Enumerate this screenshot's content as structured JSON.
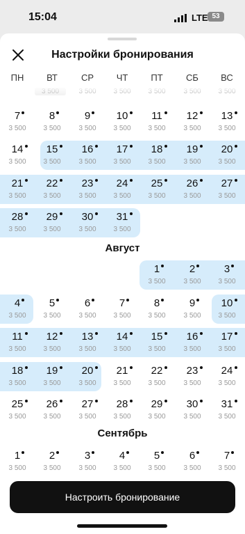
{
  "status_bar": {
    "time": "15:04",
    "network": "LTE",
    "battery": "53"
  },
  "header": {
    "title": "Настройки бронирования",
    "close_icon": "close-icon"
  },
  "weekdays": [
    "ПН",
    "ВТ",
    "СР",
    "ЧТ",
    "ПТ",
    "СБ",
    "ВС"
  ],
  "colors": {
    "selected_range": "#d6ecfb",
    "button": "#111111"
  },
  "july": {
    "top_row_price": "3 500",
    "weeks": [
      [
        {
          "day": "7",
          "price": "3 500"
        },
        {
          "day": "8",
          "price": "3 500"
        },
        {
          "day": "9",
          "price": "3 500"
        },
        {
          "day": "10",
          "price": "3 500"
        },
        {
          "day": "11",
          "price": "3 500"
        },
        {
          "day": "12",
          "price": "3 500"
        },
        {
          "day": "13",
          "price": "3 500"
        }
      ],
      [
        {
          "day": "14",
          "price": "3 500"
        },
        {
          "day": "15",
          "price": "3 500"
        },
        {
          "day": "16",
          "price": "3 500"
        },
        {
          "day": "17",
          "price": "3 500"
        },
        {
          "day": "18",
          "price": "3 500"
        },
        {
          "day": "19",
          "price": "3 500"
        },
        {
          "day": "20",
          "price": "3 500"
        }
      ],
      [
        {
          "day": "21",
          "price": "3 500"
        },
        {
          "day": "22",
          "price": "3 500"
        },
        {
          "day": "23",
          "price": "3 500"
        },
        {
          "day": "24",
          "price": "3 500"
        },
        {
          "day": "25",
          "price": "3 500"
        },
        {
          "day": "26",
          "price": "3 500"
        },
        {
          "day": "27",
          "price": "3 500"
        }
      ],
      [
        {
          "day": "28",
          "price": "3 500"
        },
        {
          "day": "29",
          "price": "3 500"
        },
        {
          "day": "30",
          "price": "3 500"
        },
        {
          "day": "31",
          "price": "3 500"
        }
      ]
    ]
  },
  "august": {
    "title": "Август",
    "weeks": [
      [
        null,
        null,
        null,
        null,
        {
          "day": "1",
          "price": "3 500"
        },
        {
          "day": "2",
          "price": "3 500"
        },
        {
          "day": "3",
          "price": "3 500"
        }
      ],
      [
        {
          "day": "4",
          "price": "3 500"
        },
        {
          "day": "5",
          "price": "3 500"
        },
        {
          "day": "6",
          "price": "3 500"
        },
        {
          "day": "7",
          "price": "3 500"
        },
        {
          "day": "8",
          "price": "3 500"
        },
        {
          "day": "9",
          "price": "3 500"
        },
        {
          "day": "10",
          "price": "3 500"
        }
      ],
      [
        {
          "day": "11",
          "price": "3 500"
        },
        {
          "day": "12",
          "price": "3 500"
        },
        {
          "day": "13",
          "price": "3 500"
        },
        {
          "day": "14",
          "price": "3 500"
        },
        {
          "day": "15",
          "price": "3 500"
        },
        {
          "day": "16",
          "price": "3 500"
        },
        {
          "day": "17",
          "price": "3 500"
        }
      ],
      [
        {
          "day": "18",
          "price": "3 500"
        },
        {
          "day": "19",
          "price": "3 500"
        },
        {
          "day": "20",
          "price": "3 500"
        },
        {
          "day": "21",
          "price": "3 500"
        },
        {
          "day": "22",
          "price": "3 500"
        },
        {
          "day": "23",
          "price": "3 500"
        },
        {
          "day": "24",
          "price": "3 500"
        }
      ],
      [
        {
          "day": "25",
          "price": "3 500"
        },
        {
          "day": "26",
          "price": "3 500"
        },
        {
          "day": "27",
          "price": "3 500"
        },
        {
          "day": "28",
          "price": "3 500"
        },
        {
          "day": "29",
          "price": "3 500"
        },
        {
          "day": "30",
          "price": "3 500"
        },
        {
          "day": "31",
          "price": "3 500"
        }
      ]
    ]
  },
  "september": {
    "title": "Сентябрь",
    "weeks": [
      [
        {
          "day": "1",
          "price": "3 500"
        },
        {
          "day": "2",
          "price": "3 500"
        },
        {
          "day": "3",
          "price": "3 500"
        },
        {
          "day": "4",
          "price": "3 500"
        },
        {
          "day": "5",
          "price": "3 500"
        },
        {
          "day": "6",
          "price": "3 500"
        },
        {
          "day": "7",
          "price": "3 500"
        }
      ]
    ]
  },
  "footer": {
    "button_label": "Настроить бронирование"
  }
}
